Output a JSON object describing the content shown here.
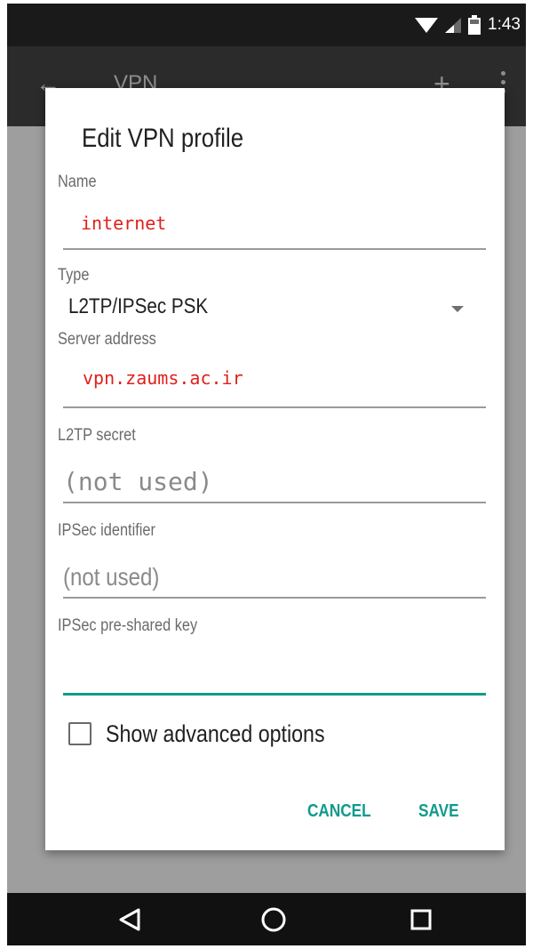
{
  "status_bar": {
    "time": "1:43",
    "icons": [
      "wifi-icon",
      "signal-icon",
      "battery-icon"
    ]
  },
  "app_bar": {
    "title": "VPN",
    "icons": [
      "back-arrow-icon",
      "add-icon",
      "more-vert-icon"
    ]
  },
  "dialog": {
    "title": "Edit VPN profile",
    "name": {
      "label": "Name",
      "value": "internet"
    },
    "type": {
      "label": "Type",
      "value": "L2TP/IPSec PSK"
    },
    "server": {
      "label": "Server address",
      "value": "vpn.zaums.ac.ir"
    },
    "l2tp_secret": {
      "label": "L2TP secret",
      "placeholder": "(not used)"
    },
    "ipsec_identifier": {
      "label": "IPSec identifier",
      "placeholder": "(not used)"
    },
    "ipsec_psk": {
      "label": "IPSec pre-shared key",
      "value": ""
    },
    "advanced": {
      "label": "Show advanced options",
      "checked": false
    },
    "cancel_label": "CANCEL",
    "save_label": "SAVE"
  },
  "nav_bar": {
    "icons": [
      "back-triangle-icon",
      "home-circle-icon",
      "recents-square-icon"
    ]
  },
  "colors": {
    "accent": "#119a8c",
    "annotation_red": "#e0201b",
    "status_bar": "#1a1a1a",
    "app_bar": "#2b2b2b",
    "scrim": "#9e9e9e"
  }
}
